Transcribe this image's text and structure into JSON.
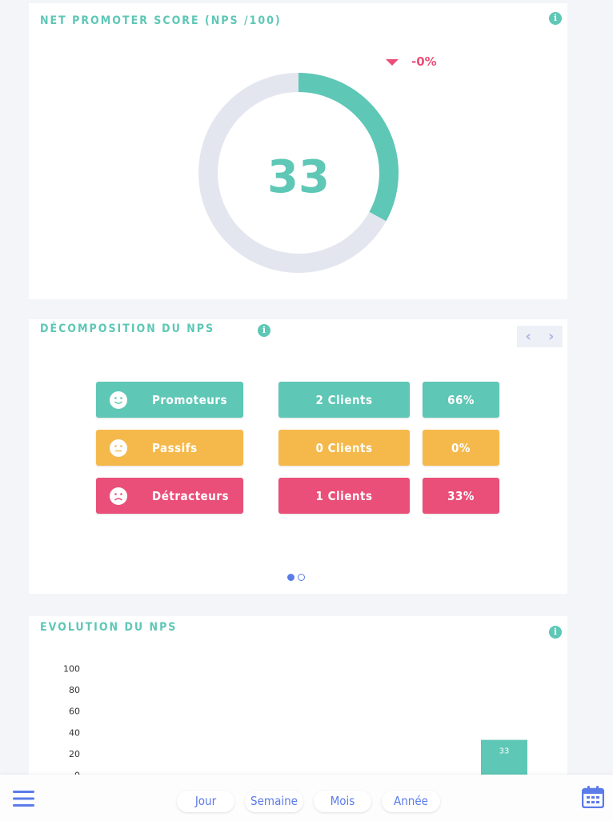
{
  "nps_card": {
    "title": "NET PROMOTER SCORE (NPS /100)",
    "trend_value": "-0%",
    "score": "33",
    "score_fraction": 0.33,
    "colors": {
      "accent": "#5ec7b6",
      "track": "#e4e6ef",
      "negative": "#e94f79"
    }
  },
  "breakdown_card": {
    "title": "DÉCOMPOSITION DU NPS",
    "rows": [
      {
        "label": "Promoteurs",
        "count": "2 Clients",
        "percent": "66%",
        "color": "#5ec7b6",
        "face": "smile"
      },
      {
        "label": "Passifs",
        "count": "0 Clients",
        "percent": "0%",
        "color": "#f5b94b",
        "face": "neutral"
      },
      {
        "label": "Détracteurs",
        "count": "1 Clients",
        "percent": "33%",
        "color": "#e94f79",
        "face": "sad"
      }
    ],
    "pagination": {
      "pages": 2,
      "current": 1
    }
  },
  "evolution_card": {
    "title": "EVOLUTION DU NPS"
  },
  "chart_data": {
    "type": "bar",
    "title": "EVOLUTION DU NPS",
    "yticks": [
      100,
      80,
      60,
      40,
      20,
      0
    ],
    "ylim": [
      0,
      100
    ],
    "series": [
      {
        "values": [
          33
        ],
        "color": "#5ec7b6"
      }
    ],
    "data_labels": [
      "33"
    ]
  },
  "bottom_bar": {
    "periods": [
      "Jour",
      "Semaine",
      "Mois",
      "Année"
    ],
    "menu_icon": "menu-icon",
    "calendar_icon": "calendar-icon"
  }
}
